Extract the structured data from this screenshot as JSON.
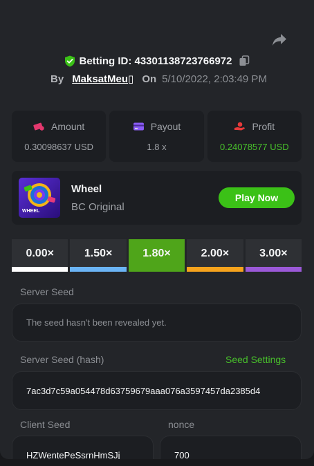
{
  "header": {
    "bet_id_label": "Betting ID: 4330113872376697​2",
    "by_label": "By",
    "username": "MaksatMeu▯",
    "on_label": "On",
    "date": "5/10/2022, 2:03:49 PM"
  },
  "stats": {
    "amount": {
      "label": "Amount",
      "value": "0.30098637 USD",
      "icon": "money-icon"
    },
    "payout": {
      "label": "Payout",
      "value": "1.8 x",
      "icon": "card-icon"
    },
    "profit": {
      "label": "Profit",
      "value": "0.24078577 USD",
      "icon": "hand-coin-icon"
    }
  },
  "game": {
    "title": "Wheel",
    "subtitle": "BC Original",
    "play_label": "Play Now",
    "thumb_text": "WHEEL"
  },
  "multipliers": [
    {
      "label": "0.00×",
      "color": "#ffffff",
      "active": false
    },
    {
      "label": "1.50×",
      "color": "#6bb4f5",
      "active": false
    },
    {
      "label": "1.80×",
      "color": "#4fa51a",
      "active": true
    },
    {
      "label": "2.00×",
      "color": "#f6a31d",
      "active": false
    },
    {
      "label": "3.00×",
      "color": "#9b59d8",
      "active": false
    }
  ],
  "server_seed": {
    "label": "Server Seed",
    "value": "The seed hasn't been revealed yet."
  },
  "server_seed_hash": {
    "label": "Server Seed (hash)",
    "link": "Seed Settings",
    "value": "7ac3d7c59a054478d63759679aaa076a3597457da2385d4"
  },
  "client_seed": {
    "label": "Client Seed",
    "value": "HZWentePeSsrnHmSJj"
  },
  "nonce": {
    "label": "nonce",
    "value": "700"
  },
  "colors": {
    "accent": "#3bc117",
    "background": "#232529",
    "card": "#1c1e22"
  }
}
